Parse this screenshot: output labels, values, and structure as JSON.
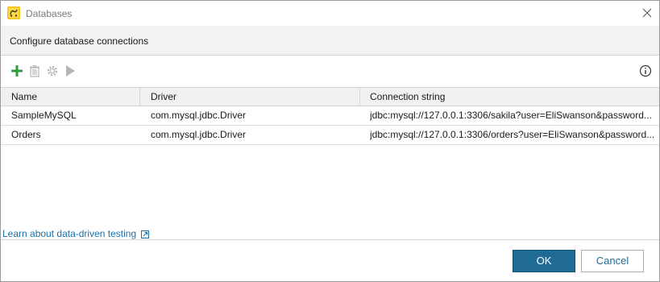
{
  "window": {
    "title": "Databases",
    "app_icon": "testcomplete-app-icon",
    "close_icon": "close-icon"
  },
  "header": {
    "text": "Configure database connections"
  },
  "toolbar": {
    "buttons": [
      {
        "name": "add-connection-button",
        "icon": "plus-icon",
        "color": "#2e9e3c",
        "enabled": true
      },
      {
        "name": "delete-connection-button",
        "icon": "trash-icon",
        "color": "#b5b5b5",
        "enabled": false
      },
      {
        "name": "connection-settings-button",
        "icon": "gear-icon",
        "color": "#b5b5b5",
        "enabled": false
      },
      {
        "name": "test-connection-button",
        "icon": "play-icon",
        "color": "#b5b5b5",
        "enabled": false
      }
    ],
    "info_icon": "info-icon"
  },
  "table": {
    "columns": [
      "Name",
      "Driver",
      "Connection string"
    ],
    "rows": [
      [
        "SampleMySQL",
        "com.mysql.jdbc.Driver",
        "jdbc:mysql://127.0.0.1:3306/sakila?user=EliSwanson&password..."
      ],
      [
        "Orders",
        "com.mysql.jdbc.Driver",
        "jdbc:mysql://127.0.0.1:3306/orders?user=EliSwanson&password..."
      ]
    ]
  },
  "learn_link": {
    "text": "Learn about data-driven testing",
    "icon": "external-link-icon",
    "color": "#1a6fa8"
  },
  "footer": {
    "ok_label": "OK",
    "cancel_label": "Cancel",
    "accent": "#1f6b96"
  }
}
